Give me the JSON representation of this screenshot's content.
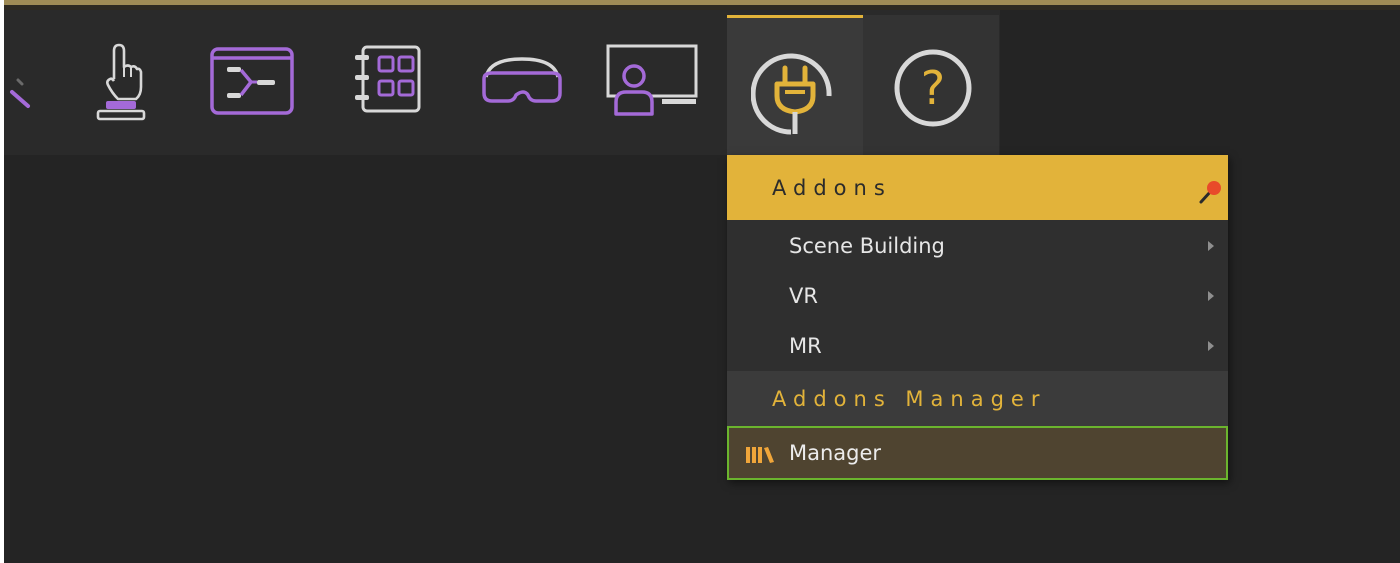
{
  "app": {
    "accent_color": "#e2b33a",
    "icon_purple": "#a46ad8",
    "active_outline_color": "#6bb52e"
  },
  "toolbar": {
    "icons": [
      "draw-tool-icon",
      "hand-press-button-icon",
      "flow-editor-icon",
      "grid-panel-icon",
      "vr-headset-icon",
      "presenter-screen-icon",
      "plug-icon",
      "help-icon"
    ],
    "help_glyph": "?"
  },
  "menu": {
    "header_addons": "Addons",
    "items": [
      {
        "label": "Scene Building",
        "has_submenu": true
      },
      {
        "label": "VR",
        "has_submenu": true
      },
      {
        "label": "MR",
        "has_submenu": true
      }
    ],
    "header_manager": "Addons Manager",
    "manager_item": "Manager"
  }
}
